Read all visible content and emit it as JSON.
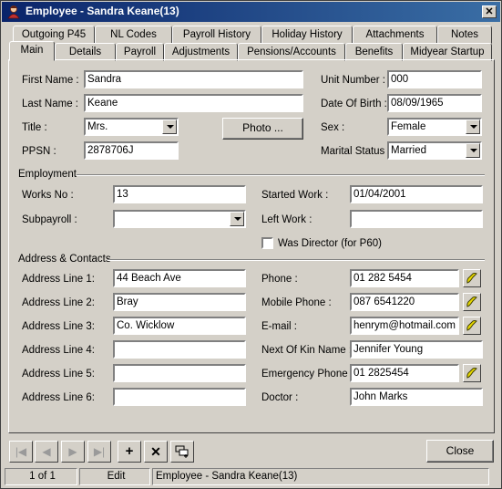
{
  "window": {
    "title": "Employee - Sandra Keane(13)",
    "close_glyph": "✕"
  },
  "tabs_row1": [
    "Outgoing P45",
    "NL Codes",
    "Payroll History",
    "Holiday History",
    "Attachments",
    "Notes"
  ],
  "tabs_row2": [
    "Main",
    "Details",
    "Payroll",
    "Adjustments",
    "Pensions/Accounts",
    "Benefits",
    "Midyear Startup"
  ],
  "main": {
    "first_name_label": "First Name :",
    "first_name": "Sandra",
    "last_name_label": "Last Name :",
    "last_name": "Keane",
    "title_label": "Title :",
    "title": "Mrs.",
    "ppsn_label": "PPSN :",
    "ppsn": "2878706J",
    "photo_label": "Photo ...",
    "unit_label": "Unit Number :",
    "unit": "000",
    "dob_label": "Date Of Birth :",
    "dob": "08/09/1965",
    "sex_label": "Sex :",
    "sex": "Female",
    "marital_label": "Marital Status :",
    "marital": "Married"
  },
  "employment": {
    "group_label": "Employment",
    "works_no_label": "Works No :",
    "works_no": "13",
    "subpayroll_label": "Subpayroll :",
    "subpayroll": "",
    "started_label": "Started Work :",
    "started": "01/04/2001",
    "left_label": "Left Work :",
    "left": "",
    "director_label": "Was Director (for P60)"
  },
  "address": {
    "group_label": "Address & Contacts",
    "line1_label": "Address Line 1:",
    "line1": "44 Beach Ave",
    "line2_label": "Address Line 2:",
    "line2": "Bray",
    "line3_label": "Address Line 3:",
    "line3": "Co. Wicklow",
    "line4_label": "Address Line 4:",
    "line4": "",
    "line5_label": "Address Line 5:",
    "line5": "",
    "line6_label": "Address Line 6:",
    "line6": "",
    "phone_label": "Phone :",
    "phone": "01 282 5454",
    "mobile_label": "Mobile Phone :",
    "mobile": "087 6541220",
    "email_label": "E-mail :",
    "email": "henrym@hotmail.com",
    "kin_label": "Next Of Kin Name :",
    "kin": "Jennifer Young",
    "emergency_label": "Emergency Phone :",
    "emergency": "01 2825454",
    "doctor_label": "Doctor :",
    "doctor": "John Marks"
  },
  "footer": {
    "close_label": "Close",
    "record": "1 of 1",
    "mode": "Edit",
    "status": "Employee - Sandra Keane(13)"
  },
  "colors": {
    "title_start": "#0a246a",
    "title_end": "#3a6ea5",
    "face": "#d4d0c8",
    "phone_icon": "#e8d800"
  }
}
